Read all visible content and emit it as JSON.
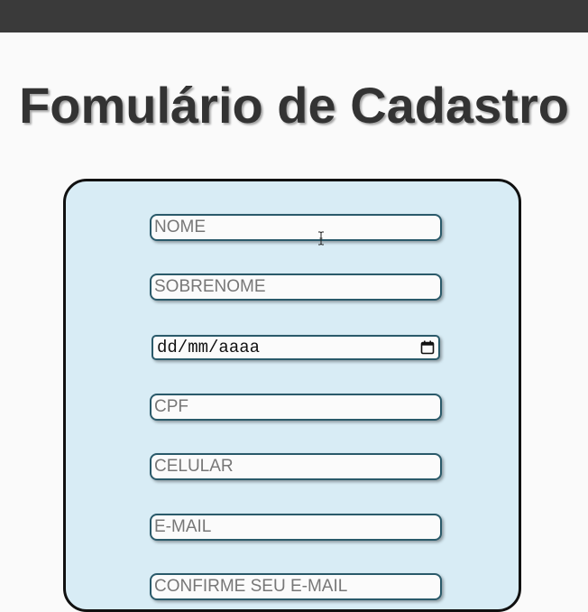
{
  "page": {
    "title": "Fomulário de Cadastro"
  },
  "form": {
    "fields": {
      "nome": {
        "placeholder": "NOME",
        "value": ""
      },
      "sobrenome": {
        "placeholder": "SOBRENOME",
        "value": ""
      },
      "data_nascimento": {
        "display": "dd/mm/aaaa",
        "icon": "calendar-icon"
      },
      "cpf": {
        "placeholder": "CPF",
        "value": ""
      },
      "celular": {
        "placeholder": "CELULAR",
        "value": ""
      },
      "email": {
        "placeholder": "E-MAIL",
        "value": ""
      },
      "confirme_email": {
        "placeholder": "CONFIRME SEU E-MAIL",
        "value": ""
      }
    }
  },
  "colors": {
    "top_bar": "#3a3a3a",
    "card_background": "#d8ecf5",
    "field_border": "#2a5a6a",
    "title_text": "#333333"
  },
  "cursor": {
    "icon": "text-cursor-icon"
  }
}
